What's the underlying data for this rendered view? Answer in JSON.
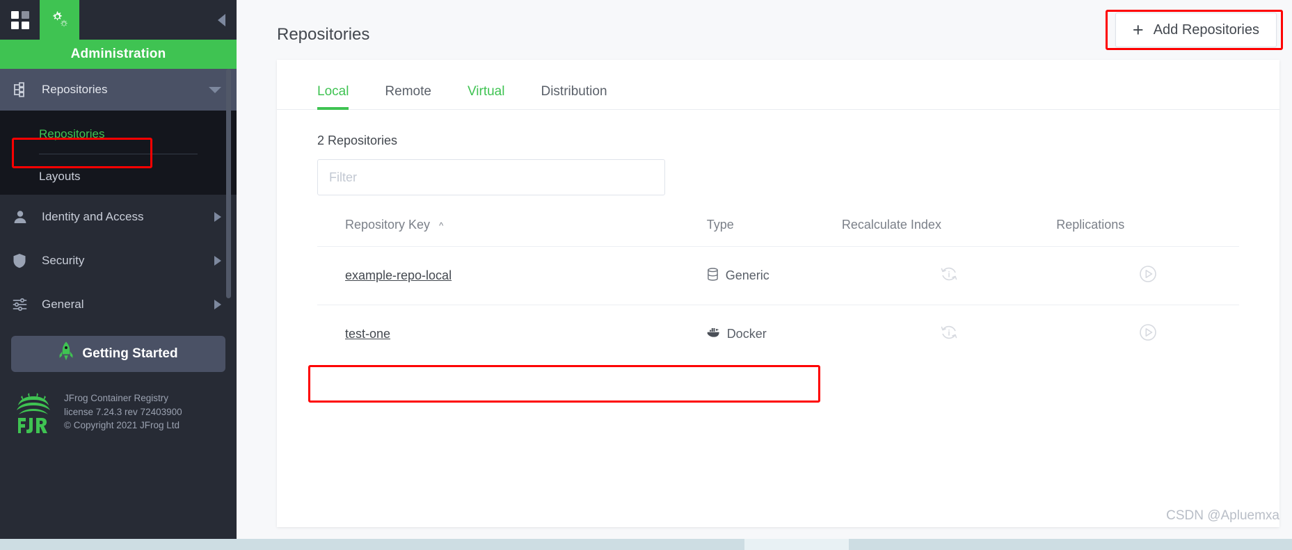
{
  "topbar": {
    "grid_icon": "grid-icon",
    "gears_icon": "gears-icon",
    "collapse_icon": "collapse-left-icon"
  },
  "sidebar": {
    "banner": "Administration",
    "group": {
      "label": "Repositories",
      "icon": "repository-tree-icon",
      "caret": "chevron-down-icon",
      "children": [
        {
          "label": "Repositories",
          "active": true
        },
        {
          "label": "Layouts",
          "active": false
        }
      ]
    },
    "items": [
      {
        "label": "Identity and Access",
        "icon": "user-icon",
        "arrow": "chevron-right-icon"
      },
      {
        "label": "Security",
        "icon": "shield-icon",
        "arrow": "chevron-right-icon"
      },
      {
        "label": "General",
        "icon": "sliders-icon",
        "arrow": "chevron-right-icon"
      }
    ],
    "getting_started": {
      "label": "Getting Started",
      "icon": "rocket-icon"
    },
    "footer": {
      "logo": "jfrog-logo",
      "line1": "JFrog Container Registry",
      "line2": "license 7.24.3 rev 72403900",
      "line3": "© Copyright 2021 JFrog Ltd"
    }
  },
  "header": {
    "title": "Repositories",
    "add_button": {
      "label": "Add Repositories",
      "icon": "plus-icon"
    }
  },
  "tabs": [
    {
      "label": "Local",
      "state": "active"
    },
    {
      "label": "Remote",
      "state": "default"
    },
    {
      "label": "Virtual",
      "state": "highlight"
    },
    {
      "label": "Distribution",
      "state": "default"
    }
  ],
  "content": {
    "repo_count": "2 Repositories",
    "filter_placeholder": "Filter",
    "filter_value": ""
  },
  "table": {
    "columns": [
      "Repository Key",
      "Type",
      "Recalculate Index",
      "Replications"
    ],
    "sort_column": "Repository Key",
    "sort_caret": "chevron-up-icon",
    "rows": [
      {
        "key": "example-repo-local",
        "type": "Generic",
        "type_icon": "database-icon",
        "recalculate_icon": "recalculate-index-icon",
        "replication_icon": "play-circle-icon"
      },
      {
        "key": "test-one",
        "type": "Docker",
        "type_icon": "docker-whale-icon",
        "recalculate_icon": "recalculate-index-icon",
        "replication_icon": "play-circle-icon"
      }
    ]
  },
  "annotations": {
    "highlight_color": "#fe0000",
    "boxes": [
      "add-repositories-button",
      "sidebar-repositories-subitem",
      "test-one-row"
    ]
  },
  "watermark": "CSDN @Apluemxa",
  "colors": {
    "brand_green": "#3fc352",
    "sidebar_dark": "#272b35",
    "sidebar_darker": "#14161d",
    "nav_group_bg": "#4a5165"
  }
}
